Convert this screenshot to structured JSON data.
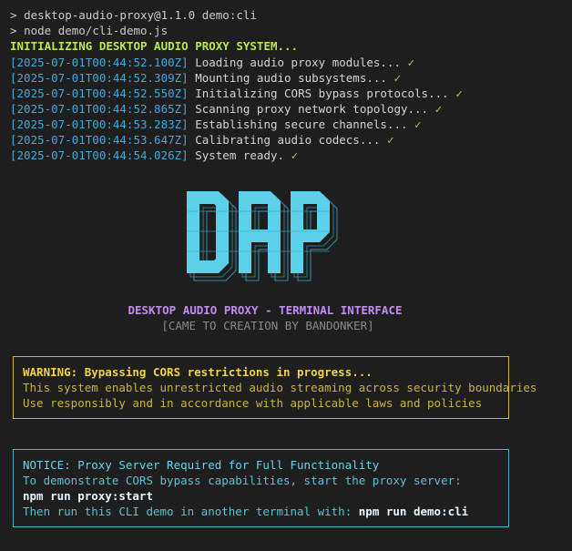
{
  "terminal": {
    "prompt_symbol": ">",
    "commands": [
      "desktop-audio-proxy@1.1.0 demo:cli",
      "node demo/cli-demo.js"
    ],
    "init_message": "INITIALIZING DESKTOP AUDIO PROXY SYSTEM...",
    "logs": [
      {
        "timestamp": "[2025-07-01T00:44:52.100Z]",
        "message": "Loading audio proxy modules...",
        "status": "✓"
      },
      {
        "timestamp": "[2025-07-01T00:44:52.309Z]",
        "message": "Mounting audio subsystems...",
        "status": "✓"
      },
      {
        "timestamp": "[2025-07-01T00:44:52.550Z]",
        "message": "Initializing CORS bypass protocols...",
        "status": "✓"
      },
      {
        "timestamp": "[2025-07-01T00:44:52.865Z]",
        "message": "Scanning proxy network topology...",
        "status": "✓"
      },
      {
        "timestamp": "[2025-07-01T00:44:53.283Z]",
        "message": "Establishing secure channels...",
        "status": "✓"
      },
      {
        "timestamp": "[2025-07-01T00:44:53.647Z]",
        "message": "Calibrating audio codecs...",
        "status": "✓"
      },
      {
        "timestamp": "[2025-07-01T00:44:54.026Z]",
        "message": "System ready.",
        "status": "✓"
      }
    ]
  },
  "banner": {
    "logo_text": "DAP",
    "subtitle": "DESKTOP AUDIO PROXY - TERMINAL INTERFACE",
    "credit": "[CAME TO CREATION BY BANDONKER]"
  },
  "warning": {
    "heading": "WARNING: Bypassing CORS restrictions in progress...",
    "lines": [
      "This system enables unrestricted audio streaming across security boundaries",
      "Use responsibly and in accordance with applicable laws and policies"
    ]
  },
  "notice": {
    "heading": "NOTICE: Proxy Server Required for Full Functionality",
    "line1": "To demonstrate CORS bypass capabilities, start the proxy server:",
    "command1": "npm run proxy:start",
    "line2_prefix": "Then run this CLI demo in another terminal with: ",
    "command2": "npm run demo:cli"
  },
  "colors": {
    "background": "#1e1e1e",
    "timestamp": "#4aa7d8",
    "check": "#9ccc65",
    "logo": "#5dd0ea",
    "warning_border": "#c9b73a",
    "notice_border": "#4fb3c8"
  }
}
